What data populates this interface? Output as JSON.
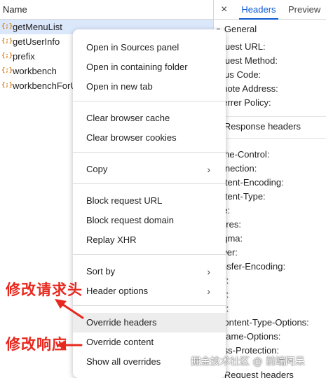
{
  "network_list": {
    "header": "Name",
    "requests": [
      {
        "name": "getMenuList",
        "selected": true,
        "icon": "{;}"
      },
      {
        "name": "getUserInfo",
        "selected": false,
        "icon": "{;}"
      },
      {
        "name": "prefix",
        "selected": false,
        "icon": "{;}"
      },
      {
        "name": "workbench",
        "selected": false,
        "icon": "{;}"
      },
      {
        "name": "workbenchForU",
        "selected": false,
        "icon": "{;}"
      }
    ]
  },
  "details_panel": {
    "close_icon": "×",
    "tabs": [
      {
        "label": "Headers",
        "active": true
      },
      {
        "label": "Preview",
        "active": false
      }
    ],
    "general": {
      "title": "General",
      "keys": [
        "Request URL:",
        "Request Method:",
        "Status Code:",
        "Remote Address:",
        "Referrer Policy:"
      ]
    },
    "response_headers": {
      "title": "Response headers",
      "keys": [
        "Cache-Control:",
        "Connection:",
        "Content-Encoding:",
        "Content-Type:",
        "Date:",
        "Expires:",
        "Pragma:",
        "Server:",
        "Transfer-Encoding:",
        "Vary:",
        "Vary:",
        "Vary:",
        "X-Content-Type-Options:",
        "X-Frame-Options:",
        "X-Xss-Protection:"
      ]
    },
    "request_headers": {
      "title": "Request headers"
    }
  },
  "context_menu": {
    "groups": [
      [
        {
          "label": "Open in Sources panel"
        },
        {
          "label": "Open in containing folder"
        },
        {
          "label": "Open in new tab"
        }
      ],
      [
        {
          "label": "Clear browser cache"
        },
        {
          "label": "Clear browser cookies"
        }
      ],
      [
        {
          "label": "Copy",
          "submenu": true
        }
      ],
      [
        {
          "label": "Block request URL"
        },
        {
          "label": "Block request domain"
        },
        {
          "label": "Replay XHR"
        }
      ],
      [
        {
          "label": "Sort by",
          "submenu": true
        },
        {
          "label": "Header options",
          "submenu": true
        }
      ],
      [
        {
          "label": "Override headers",
          "hovered": true
        },
        {
          "label": "Override content"
        },
        {
          "label": "Show all overrides"
        }
      ]
    ],
    "submenu_arrow": "›"
  },
  "annotations": {
    "override_headers_note": "修改请求头",
    "override_content_note": "修改响应",
    "color": "#e8281e"
  },
  "watermark": "掘金技术社区 @ 前端阿呆",
  "colors": {
    "accent": "#0b57d0",
    "selected_row": "#dbe7fb",
    "json_icon": "#d6821f",
    "menu_hover": "#ededed"
  }
}
